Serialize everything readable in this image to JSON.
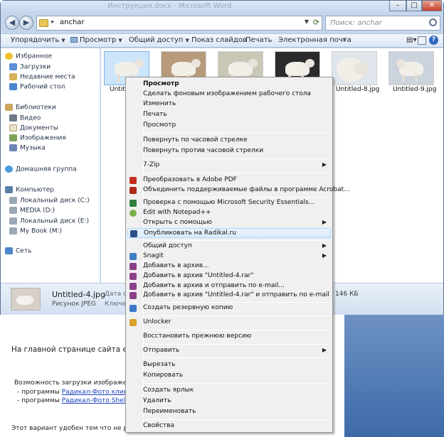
{
  "window": {
    "title": "Инструкция.docx - Microsoft Word",
    "address": "anchar",
    "search_placeholder": "Поиск: anchar"
  },
  "toolbar": {
    "organize": "Упорядочить",
    "preview": "Просмотр",
    "share": "Общий доступ",
    "slideshow": "Показ слайдов",
    "print": "Печать",
    "email": "Электронная почта",
    "more": "»"
  },
  "navpane": {
    "favorites": "Избранное",
    "downloads": "Загрузки",
    "recent": "Недавние места",
    "desktop": "Рабочий стол",
    "libraries": "Библиотеки",
    "video": "Видео",
    "documents": "Документы",
    "images": "Изображения",
    "music": "Музыка",
    "homegroup": "Домашняя группа",
    "computer": "Компьютер",
    "disk_c": "Локальный диск (C:)",
    "media_d": "MEDIA (D:)",
    "disk_e": "Локальный диск (E:)",
    "mybook_m": "My Book (M:)",
    "network": "Сеть"
  },
  "files": [
    {
      "name": "Untitled-4.jpg",
      "shown": "Untitl"
    },
    {
      "name": "",
      "shown": ""
    },
    {
      "name": "",
      "shown": ""
    },
    {
      "name": "",
      "shown": ""
    },
    {
      "name": "Untitled-8.jpg",
      "shown": "Untitled-8.jpg"
    },
    {
      "name": "Untitled-9.jpg",
      "shown": "Untitled-9.jpg"
    }
  ],
  "details": {
    "name": "Untitled-4.jpg",
    "type": "Рисунок JPEG",
    "date_label": "Дата сь",
    "keywords_label": "Ключевые с",
    "size": "146 КБ"
  },
  "context_menu": {
    "preview_bold": "Просмотр",
    "set_wallpaper": "Сделать фоновым изображением рабочего стола",
    "edit": "Изменить",
    "print": "Печать",
    "preview": "Просмотр",
    "rotate_cw": "Повернуть по часовой стрелке",
    "rotate_ccw": "Повернуть против часовой стрелки",
    "sevenzip": "7-Zip",
    "to_pdf": "Преобразовать в Adobe PDF",
    "combine_acrobat": "Объединить поддерживаемые файлы в программе Acrobat...",
    "mse_scan": "Проверка с помощью Microsoft Security Essentials...",
    "notepadpp": "Edit with Notepad++",
    "open_with": "Открыть с помощью",
    "radikal": "Опубликовать на Radikal.ru",
    "share": "Общий доступ",
    "snagit": "Snagit",
    "add_archive": "Добавить в архив...",
    "add_rar": "Добавить в архив \"Untitled-4.rar\"",
    "add_email": "Добавить в архив и отправить по e-mail...",
    "add_rar_email": "Добавить в архив \"Untitled-4.rar\" и отправить по e-mail",
    "backup": "Создать резервную копию",
    "unlocker": "Unlocker",
    "restore": "Восстановить прежнюю версию",
    "send_to": "Отправить",
    "cut": "Вырезать",
    "copy": "Копировать",
    "shortcut": "Создать ярлык",
    "delete": "Удалить",
    "rename": "Переименовать",
    "properties": "Свойства"
  },
  "document": {
    "line1": "На главной странице сайта есть со",
    "line2": "Возможность загрузки изображений с",
    "bullet1_prefix": "- программы",
    "bullet1_link": "Радикал-Фото клиент",
    "bullet2_prefix": "- программы",
    "bullet2_link": "Радикал-Фото ShellExten",
    "line3": "Этот вариант удобен тем что не раздра"
  }
}
